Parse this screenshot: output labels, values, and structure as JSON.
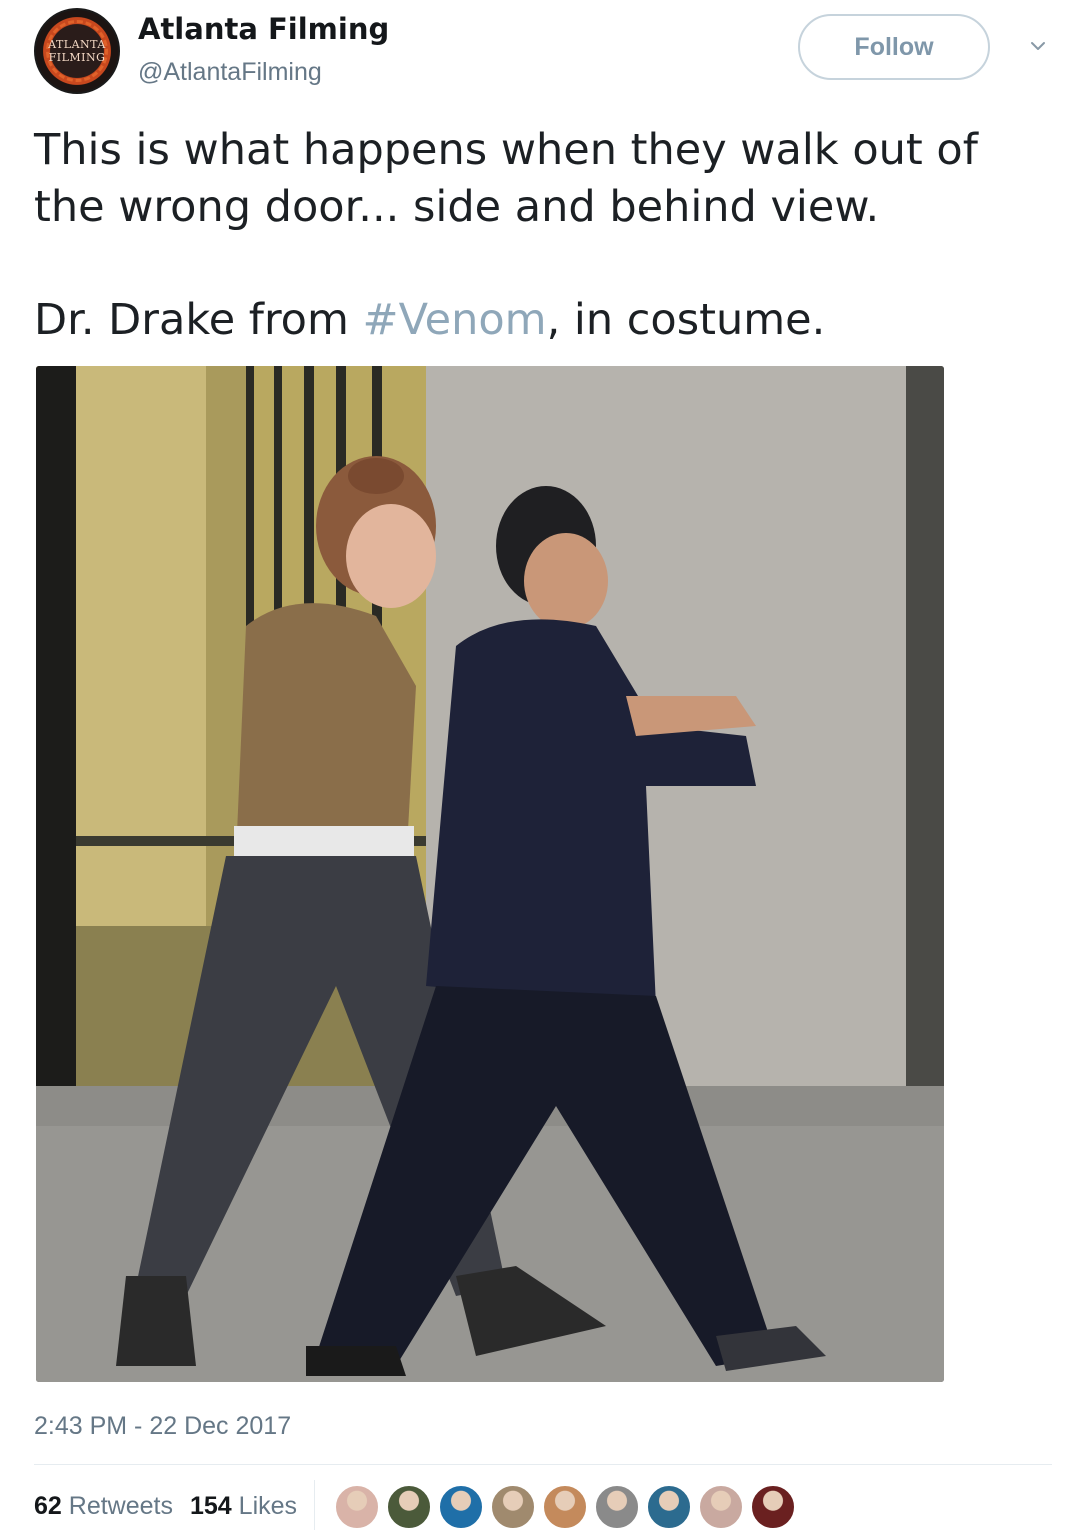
{
  "tweet": {
    "author": {
      "display_name": "Atlanta Filming",
      "handle": "@AtlantaFilming",
      "avatar_text": [
        "ATLANTA",
        "FILMING"
      ]
    },
    "follow_label": "Follow",
    "text_line1": "This is what happens when they walk out of the wrong door... side and behind view.",
    "text_line2_prefix": "Dr. Drake from ",
    "hashtag": "#Venom",
    "text_line2_suffix": ", in costume.",
    "timestamp": "2:43 PM - 22 Dec 2017",
    "retweets_count": "62",
    "retweets_label": "Retweets",
    "likes_count": "154",
    "likes_label": "Likes"
  },
  "colors": {
    "hashtag": "#8fa7b9",
    "secondary_text": "#657786",
    "follow_border": "#c6d3dc"
  },
  "icons": {
    "caret": "chevron-down-icon"
  },
  "likers": [
    {
      "color": "#d9b3a8"
    },
    {
      "color": "#4b5a3a"
    },
    {
      "color": "#1f6fa8"
    },
    {
      "color": "#a08a6e"
    },
    {
      "color": "#c48a5c"
    },
    {
      "color": "#8a8a8a"
    },
    {
      "color": "#2c6b8f"
    },
    {
      "color": "#c9a9a0"
    },
    {
      "color": "#6a2020"
    }
  ]
}
